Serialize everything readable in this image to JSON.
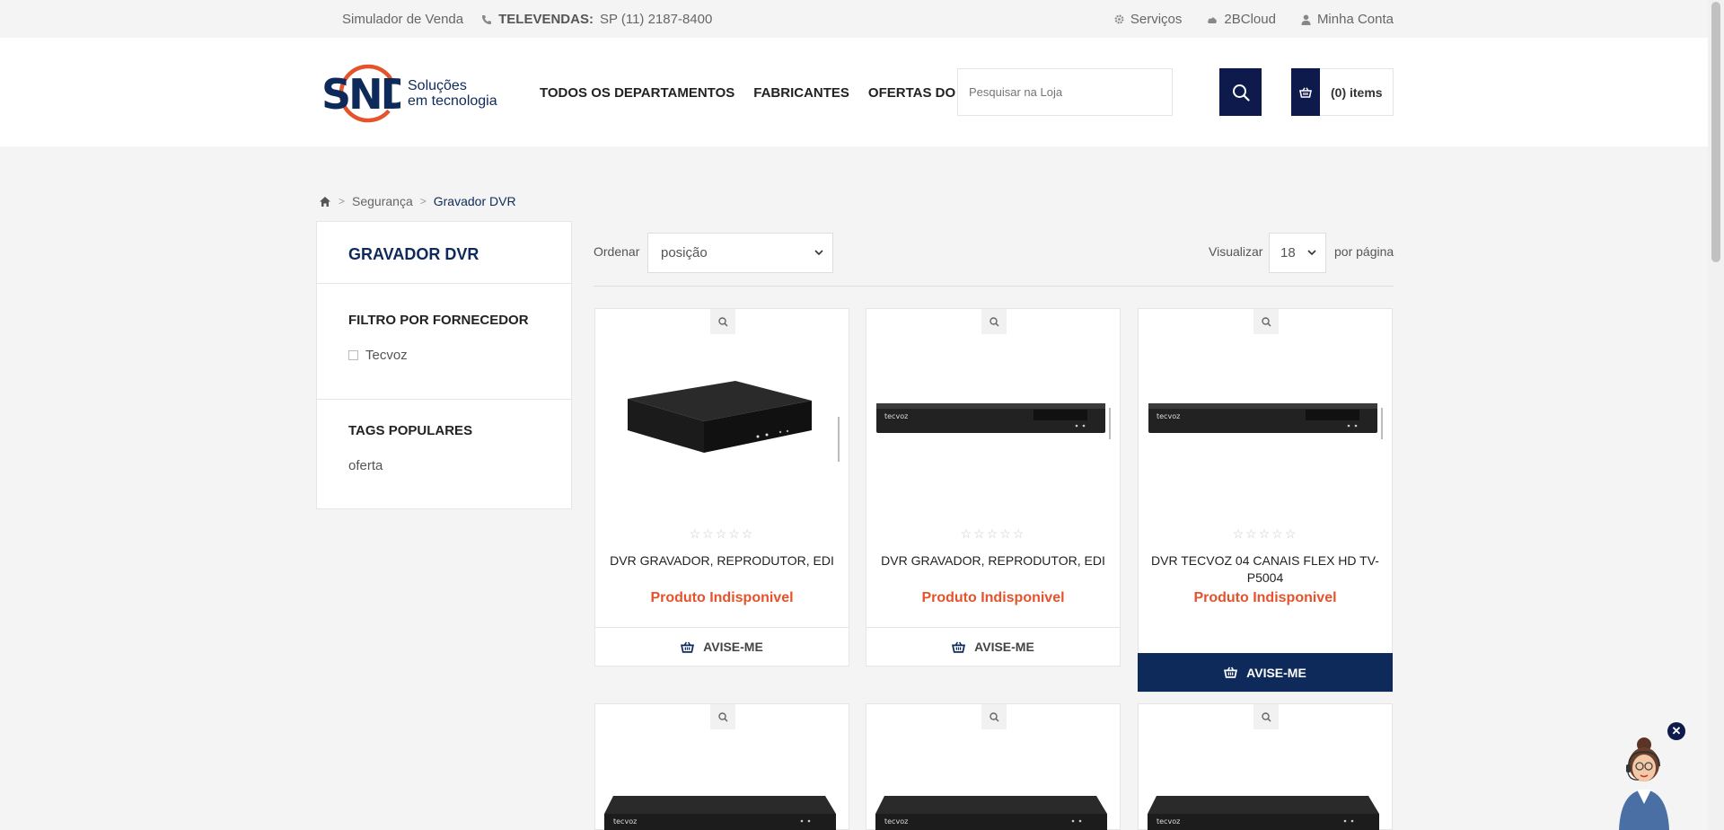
{
  "topbar": {
    "simulator": "Simulador de Venda",
    "televendas_label": "TELEVENDAS:",
    "televendas_phone": "SP (11)  2187-8400",
    "services": "Serviços",
    "cloud": "2BCloud",
    "account": "Minha Conta"
  },
  "logo": {
    "mark": "SND",
    "line1": "Soluções",
    "line2": "em tecnologia"
  },
  "nav": {
    "departments": "TODOS OS DEPARTAMENTOS",
    "manufacturers": "FABRICANTES",
    "offers": "OFERTAS DO DIA"
  },
  "search": {
    "placeholder": "Pesquisar na Loja"
  },
  "cart": {
    "label": "(0) items"
  },
  "breadcrumb": {
    "level1": "Segurança",
    "current": "Gravador DVR"
  },
  "sidebar": {
    "title": "GRAVADOR DVR",
    "filter_title": "FILTRO POR FORNECEDOR",
    "filter_option": "Tecvoz",
    "tags_title": "TAGS POPULARES",
    "tag": "oferta"
  },
  "toolbar": {
    "sort_label": "Ordenar",
    "sort_value": "posição",
    "view_label": "Visualizar",
    "view_value": "18",
    "per_page": "por página"
  },
  "products": [
    {
      "name": "DVR GRAVADOR, REPRODUTOR, EDI",
      "status": "Produto Indisponivel",
      "action": "AVISE-ME",
      "rating": 0
    },
    {
      "name": "DVR GRAVADOR, REPRODUTOR, EDI",
      "status": "Produto Indisponivel",
      "action": "AVISE-ME",
      "rating": 0
    },
    {
      "name": "DVR TECVOZ 04 CANAIS FLEX HD TV-P5004",
      "status": "Produto Indisponivel",
      "action": "AVISE-ME",
      "rating": 0
    }
  ],
  "brand_on_device": "tecvoz",
  "colors": {
    "navy": "#0e1a4b",
    "brand_blue": "#0e2a5a",
    "accent_red": "#e4532c"
  }
}
